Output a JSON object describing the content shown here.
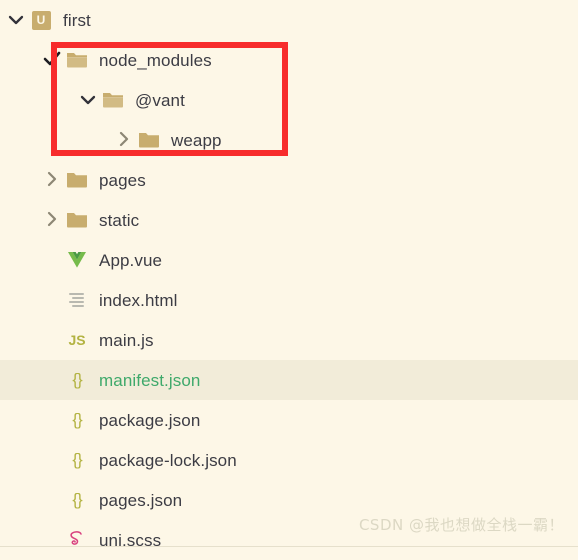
{
  "panel": {
    "background_color": "#fdf7e7",
    "selected_row_color": "#f2ecd9",
    "text_color": "#3c3c44",
    "accent_green": "#3fa96b",
    "annotation_color": "#f72c2c",
    "folder_color": "#c8ad6e"
  },
  "tree": [
    {
      "label": "first",
      "icon": "uniapp-badge-icon",
      "icon_text": "U",
      "twisty": "chevron-down-icon",
      "depth": 0,
      "selected": false
    },
    {
      "label": "node_modules",
      "icon": "folder-open-icon",
      "twisty": "check-icon",
      "depth": 1,
      "selected": false
    },
    {
      "label": "@vant",
      "icon": "folder-open-icon",
      "twisty": "chevron-down-icon",
      "depth": 2,
      "selected": false
    },
    {
      "label": "weapp",
      "icon": "folder-closed-icon",
      "twisty": "chevron-right-icon",
      "depth": 3,
      "selected": false
    },
    {
      "label": "pages",
      "icon": "folder-closed-icon",
      "twisty": "chevron-right-icon",
      "depth": 1,
      "selected": false
    },
    {
      "label": "static",
      "icon": "folder-closed-icon",
      "twisty": "chevron-right-icon",
      "depth": 1,
      "selected": false
    },
    {
      "label": "App.vue",
      "icon": "vue-file-icon",
      "twisty": "none",
      "depth": 1,
      "selected": false
    },
    {
      "label": "index.html",
      "icon": "html-file-icon",
      "twisty": "none",
      "depth": 1,
      "selected": false
    },
    {
      "label": "main.js",
      "icon": "js-file-icon",
      "icon_text": "JS",
      "twisty": "none",
      "depth": 1,
      "selected": false
    },
    {
      "label": "manifest.json",
      "icon": "json-file-icon",
      "icon_text": "{}",
      "twisty": "none",
      "depth": 1,
      "selected": true
    },
    {
      "label": "package.json",
      "icon": "json-file-icon",
      "icon_text": "{}",
      "twisty": "none",
      "depth": 1,
      "selected": false
    },
    {
      "label": "package-lock.json",
      "icon": "json-file-icon",
      "icon_text": "{}",
      "twisty": "none",
      "depth": 1,
      "selected": false
    },
    {
      "label": "pages.json",
      "icon": "json-file-icon",
      "icon_text": "{}",
      "twisty": "none",
      "depth": 1,
      "selected": false
    },
    {
      "label": "uni.scss",
      "icon": "sass-file-icon",
      "twisty": "none",
      "depth": 1,
      "selected": false
    }
  ],
  "annotation": {
    "name": "red-highlight-box",
    "covers": [
      "node_modules",
      "@vant",
      "weapp"
    ]
  },
  "watermark": {
    "text": "CSDN @我也想做全栈一霸！"
  }
}
